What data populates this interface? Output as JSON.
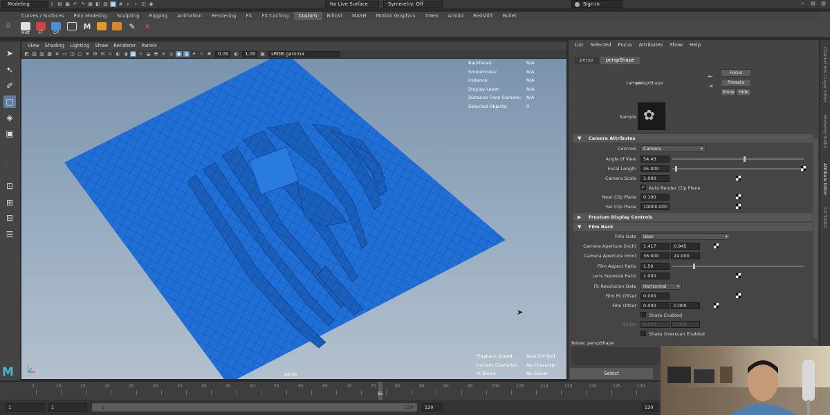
{
  "status_line": {
    "mode": "Modeling",
    "live_surface": "No Live Surface",
    "symmetry": "Symmetry: Off",
    "sign_in": "Sign In"
  },
  "shelf": {
    "tabs": [
      "Curves / Surfaces",
      "Poly Modeling",
      "Sculpting",
      "Rigging",
      "Animation",
      "Rendering",
      "FX",
      "FX Caching",
      "Custom",
      "Bifrost",
      "MASH",
      "Motion Graphics",
      "XGen",
      "Arnold",
      "Redshift",
      "Bullet"
    ],
    "active_tab": "Custom",
    "icon_labels": [
      "Hist",
      "FT",
      "CP"
    ]
  },
  "viewport": {
    "menu": [
      "View",
      "Shading",
      "Lighting",
      "Show",
      "Renderer",
      "Panels"
    ],
    "exposure": "0.00",
    "gamma": "1.00",
    "color_space": "sRGB gamma",
    "hud_top": [
      {
        "label": "Backfaces:",
        "value": "N/A"
      },
      {
        "label": "Smoothness:",
        "value": "N/A"
      },
      {
        "label": "Instance:",
        "value": "N/A"
      },
      {
        "label": "Display Layer:",
        "value": "N/A"
      },
      {
        "label": "Distance From Camera:",
        "value": "N/A"
      },
      {
        "label": "Selected Objects:",
        "value": "0"
      }
    ],
    "hud_bottom": [
      {
        "label": "Playback Speed:",
        "value": "Real [24 fps]"
      },
      {
        "label": "Current Character:",
        "value": "No Character"
      },
      {
        "label": "IK Blend:",
        "value": "No Solver"
      }
    ],
    "camera": "persp",
    "mesh_color": "#1f6fd6"
  },
  "timeline": {
    "ticks": [
      "5",
      "10",
      "15",
      "20",
      "25",
      "30",
      "35",
      "40",
      "45",
      "50",
      "55",
      "60",
      "65",
      "70",
      "75",
      "80",
      "85",
      "90",
      "95",
      "100",
      "105",
      "110",
      "115",
      "120",
      "125",
      "130"
    ],
    "current_frame": "65",
    "range_start": "1",
    "anim_start": "1",
    "slider_start": "1",
    "slider_end": "120",
    "range_end": "120"
  },
  "attribute_editor": {
    "menu": [
      "List",
      "Selected",
      "Focus",
      "Attributes",
      "Show",
      "Help"
    ],
    "tabs": [
      "persp",
      "perspShape"
    ],
    "active_tab": "perspShape",
    "camera_label": "camera:",
    "camera_value": "perspShape",
    "buttons": {
      "focus": "Focus",
      "presets": "Presets",
      "show": "Show",
      "hide": "Hide"
    },
    "sample_label": "Sample",
    "sections": {
      "camera_attributes": "Camera Attributes",
      "frustum": "Frustum Display Controls",
      "film_back": "Film Back"
    },
    "controls": {
      "label": "Controls",
      "value": "Camera"
    },
    "angle_of_view": {
      "label": "Angle of View",
      "value": "54.43",
      "slider": 0.55
    },
    "focal_length": {
      "label": "Focal Length",
      "value": "35.000",
      "slider": 0.02
    },
    "camera_scale": {
      "label": "Camera Scale",
      "value": "1.000"
    },
    "auto_render_clip": {
      "label": "Auto Render Clip Plane",
      "checked": "✓"
    },
    "near_clip": {
      "label": "Near Clip Plane",
      "value": "0.100"
    },
    "far_clip": {
      "label": "Far Clip Plane",
      "value": "10000.000"
    },
    "film_gate": {
      "label": "Film Gate",
      "value": "User"
    },
    "aperture_inch": {
      "label": "Camera Aperture (inch)",
      "v1": "1.417",
      "v2": "0.945"
    },
    "aperture_mm": {
      "label": "Camera Aperture (mm)",
      "v1": "36.000",
      "v2": "24.000"
    },
    "film_aspect": {
      "label": "Film Aspect Ratio",
      "value": "1.50",
      "slider": 0.16
    },
    "lens_squeeze": {
      "label": "Lens Squeeze Ratio",
      "value": "1.000"
    },
    "fit_gate": {
      "label": "Fit Resolution Gate",
      "value": "Horizontal"
    },
    "film_fit_offset": {
      "label": "Film Fit Offset",
      "value": "0.000"
    },
    "film_offset": {
      "label": "Film Offset",
      "v1": "0.000",
      "v2": "0.000"
    },
    "shake_enabled": {
      "label": "Shake Enabled"
    },
    "shake": {
      "label": "Shake",
      "v1": "0.000",
      "v2": "0.000"
    },
    "shake_overscan": {
      "label": "Shake Overscan Enabled"
    },
    "notes": "Notes:  perspShape",
    "select_button": "Select"
  },
  "side_tabs": [
    "Channel Box / Layer Editor",
    "Modeling Toolkit",
    "Attribute Editor",
    "UV Toolkit"
  ],
  "active_side_tab": "Attribute Editor"
}
